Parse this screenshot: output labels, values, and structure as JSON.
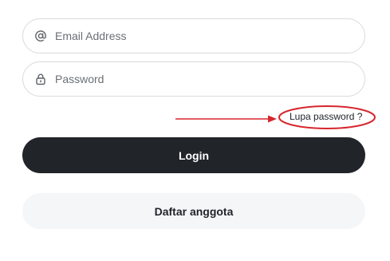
{
  "login_form": {
    "email": {
      "placeholder": "Email Address",
      "value": "",
      "icon": "at-sign-icon"
    },
    "password": {
      "placeholder": "Password",
      "value": "",
      "icon": "lock-icon"
    },
    "forgot_password_label": "Lupa password ?",
    "login_label": "Login",
    "register_label": "Daftar anggota"
  },
  "annotation": {
    "color": "#d7262e",
    "shapes": [
      "arrow",
      "ellipse"
    ]
  },
  "colors": {
    "login_bg": "#212429",
    "register_bg": "#f5f6f7",
    "field_border": "#d8dadd"
  }
}
